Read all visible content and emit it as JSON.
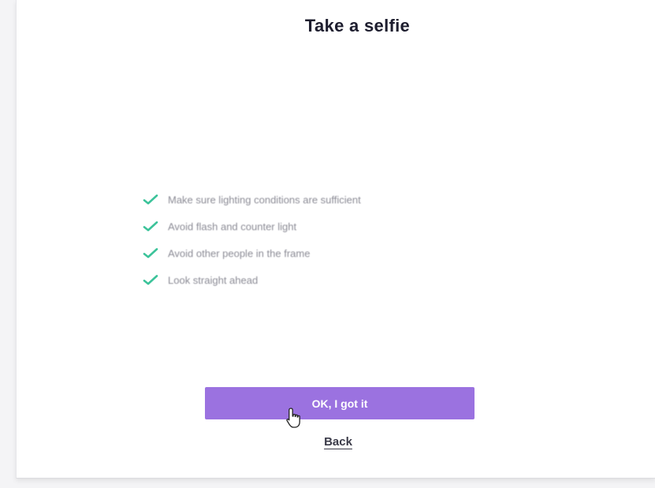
{
  "page": {
    "title": "Take a selfie"
  },
  "checklist": {
    "items": [
      {
        "text": "Make sure lighting conditions are sufficient",
        "icon": "checkmark-icon"
      },
      {
        "text": "Avoid flash and counter light",
        "icon": "checkmark-icon"
      },
      {
        "text": "Avoid other people in the frame",
        "icon": "checkmark-icon"
      },
      {
        "text": "Look straight ahead",
        "icon": "checkmark-icon"
      }
    ],
    "check_color": "#3cc39a"
  },
  "actions": {
    "primary_label": "OK, I got it",
    "primary_color": "#9b72e0",
    "back_label": "Back"
  }
}
